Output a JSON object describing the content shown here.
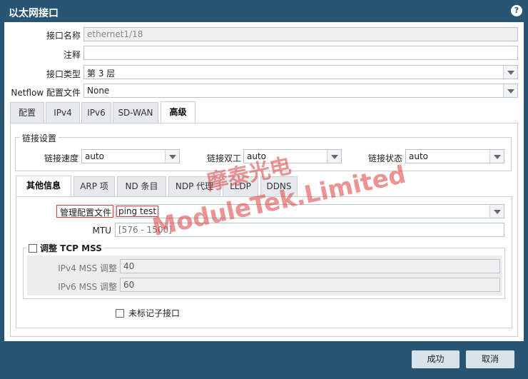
{
  "dialog": {
    "title": "以太网接口",
    "help_icon": "?"
  },
  "fields": {
    "interface_name": {
      "label": "接口名称",
      "value": "ethernet1/18"
    },
    "comment": {
      "label": "注释",
      "value": ""
    },
    "interface_type": {
      "label": "接口类型",
      "value": "第 3 层"
    },
    "netflow_profile": {
      "label": "Netflow 配置文件",
      "value": "None"
    }
  },
  "tabs": [
    "配置",
    "IPv4",
    "IPv6",
    "SD-WAN",
    "高级"
  ],
  "active_tab": "高级",
  "link_settings": {
    "legend": "链接设置",
    "speed": {
      "label": "链接速度",
      "value": "auto"
    },
    "duplex": {
      "label": "链接双工",
      "value": "auto"
    },
    "state": {
      "label": "链接状态",
      "value": "auto"
    }
  },
  "subtabs": [
    "其他信息",
    "ARP 项",
    "ND 条目",
    "NDP 代理",
    "LLDP",
    "DDNS"
  ],
  "active_subtab": "其他信息",
  "other_info": {
    "mgmt_profile": {
      "label": "管理配置文件",
      "value": "ping test"
    },
    "mtu": {
      "label": "MTU",
      "placeholder": "[576 - 1500]"
    },
    "tcp_mss": {
      "legend": "调整 TCP MSS",
      "ipv4": {
        "label": "IPv4 MSS 调整",
        "value": "40"
      },
      "ipv6": {
        "label": "IPv6 MSS 调整",
        "value": "60"
      }
    },
    "untagged": {
      "label": "未标记子接口"
    }
  },
  "buttons": {
    "ok": "成功",
    "cancel": "取消"
  },
  "watermark": {
    "line1": "摩泰光电",
    "line2": "ModuleTek.Limited"
  },
  "colors": {
    "header": "#285574",
    "highlight_border": "#d9363e"
  }
}
